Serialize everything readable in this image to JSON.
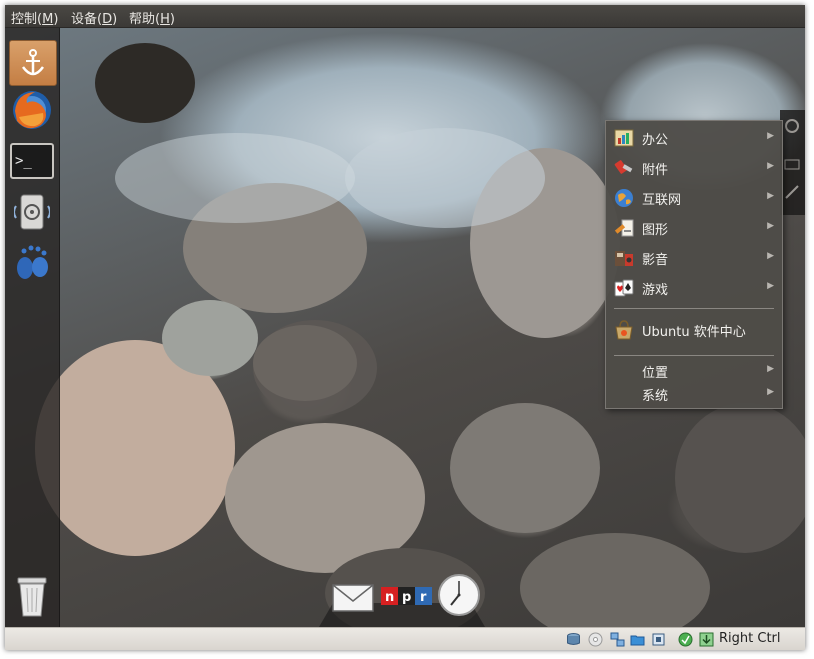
{
  "menubar": {
    "items": [
      {
        "label": "控制",
        "mnemonic": "M"
      },
      {
        "label": "设备",
        "mnemonic": "D"
      },
      {
        "label": "帮助",
        "mnemonic": "H"
      }
    ]
  },
  "launcher": {
    "items": [
      {
        "name": "anchor-icon"
      },
      {
        "name": "firefox-icon"
      },
      {
        "name": "terminal-icon"
      },
      {
        "name": "disk-utility-icon"
      },
      {
        "name": "gnome-foot-icon"
      },
      {
        "name": "trash-icon"
      }
    ]
  },
  "terminal_prompt": ">_",
  "applications_menu": {
    "items": [
      {
        "label": "办公",
        "icon": "office-icon",
        "submenu": true
      },
      {
        "label": "附件",
        "icon": "accessories-icon",
        "submenu": true
      },
      {
        "label": "互联网",
        "icon": "internet-globe-icon",
        "submenu": true
      },
      {
        "label": "图形",
        "icon": "graphics-icon",
        "submenu": true
      },
      {
        "label": "影音",
        "icon": "multimedia-icon",
        "submenu": true
      },
      {
        "label": "游戏",
        "icon": "games-cards-icon",
        "submenu": true
      },
      {
        "label": "Ubuntu 软件中心",
        "icon": "software-center-icon",
        "submenu": false
      },
      {
        "label": "位置",
        "icon": "",
        "submenu": true
      },
      {
        "label": "系统",
        "icon": "",
        "submenu": true
      }
    ],
    "arrow": "▶"
  },
  "dock": {
    "items": [
      {
        "name": "mail-icon"
      },
      {
        "name": "npr-icon",
        "text": "n p r"
      },
      {
        "name": "clock-icon"
      }
    ]
  },
  "statusbar": {
    "host_key": "Right Ctrl",
    "tray_icons": [
      "hdd-icon",
      "cd-icon",
      "network-icon",
      "shared-folder-icon",
      "usb-icon",
      "capture-icon",
      "mouse-integration-icon"
    ]
  },
  "colors": {
    "launcher_active": "#c47e44",
    "menu_bg": "#4e4c48",
    "menubar_bg": "#3b3936"
  }
}
